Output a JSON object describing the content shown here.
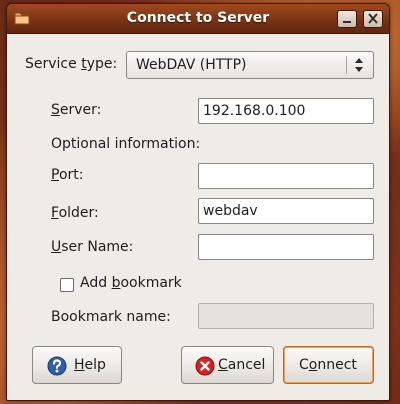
{
  "window": {
    "title": "Connect to Server"
  },
  "form": {
    "service_type_label_pre": "Service ",
    "service_type_label_mn": "t",
    "service_type_label_post": "ype:",
    "service_type_value": "WebDAV (HTTP)",
    "server_label_mn": "S",
    "server_label_post": "erver:",
    "server_value": "192.168.0.100",
    "optional_header": "Optional information:",
    "port_label_mn": "P",
    "port_label_post": "ort:",
    "port_value": "",
    "folder_label_mn": "F",
    "folder_label_post": "older:",
    "folder_value": "webdav",
    "username_label_pre": "",
    "username_label_mn": "U",
    "username_label_post": "ser Name:",
    "username_value": "",
    "add_bookmark_pre": "Add ",
    "add_bookmark_mn": "b",
    "add_bookmark_post": "ookmark",
    "add_bookmark_checked": false,
    "bookmark_name_label": "Bookmark name:",
    "bookmark_name_value": ""
  },
  "buttons": {
    "help_mn": "H",
    "help_post": "elp",
    "cancel_mn": "C",
    "cancel_post": "ancel",
    "connect_pre": "C",
    "connect_mn": "o",
    "connect_post": "nnect"
  },
  "colors": {
    "titlebar": "#7a3414",
    "dialog_bg": "#efebe7",
    "default_button_border": "#c8621c"
  },
  "icons": {
    "app": "folder-icon",
    "minimize": "minimize-icon",
    "close": "close-icon",
    "help": "help-icon",
    "cancel": "cancel-icon",
    "combo": "combo-arrows-icon"
  }
}
